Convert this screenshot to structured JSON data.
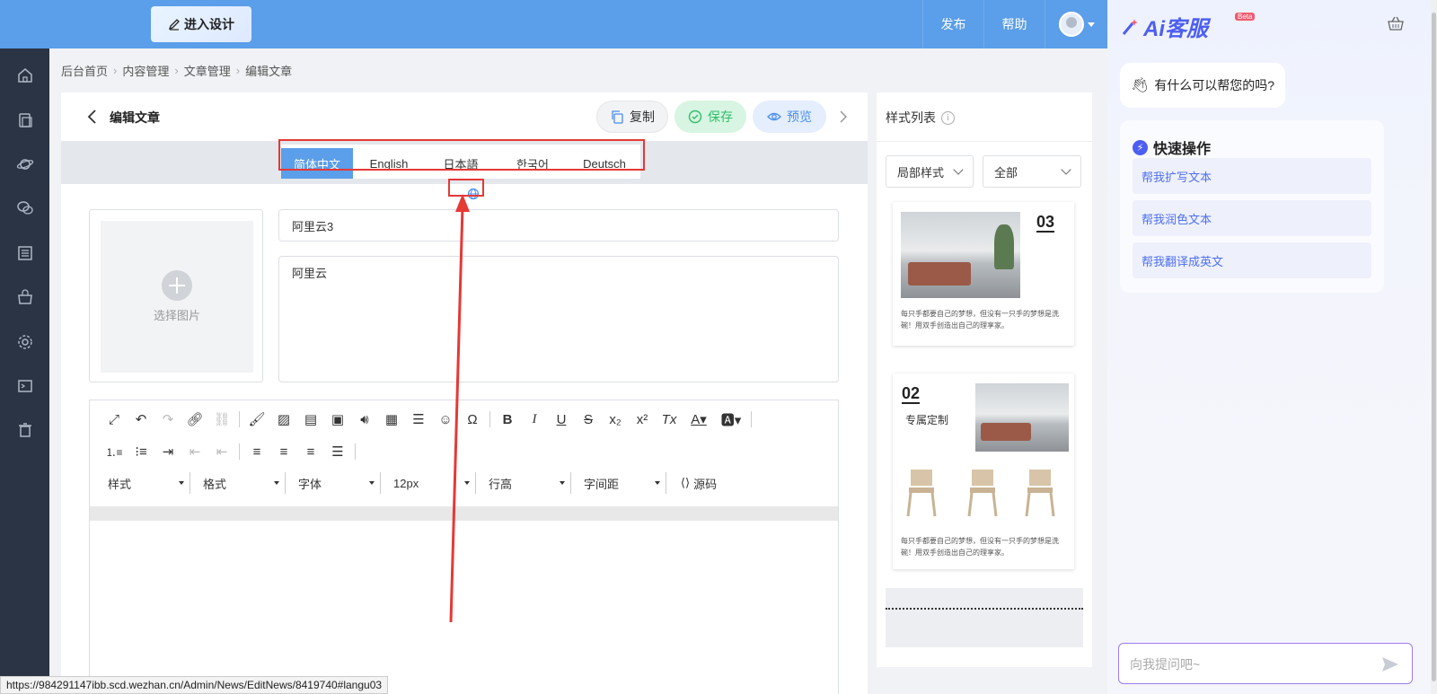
{
  "topbar": {
    "design_button": "进入设计",
    "publish": "发布",
    "help": "帮助"
  },
  "sidebar": {
    "icons": [
      "home-icon",
      "document-icon",
      "planet-icon",
      "chat-icon",
      "list-icon",
      "bag-icon",
      "gear-icon",
      "terminal-icon",
      "trash-icon"
    ]
  },
  "breadcrumb": [
    "后台首页",
    "内容管理",
    "文章管理",
    "编辑文章"
  ],
  "editor": {
    "title": "编辑文章",
    "copy_label": "复制",
    "save_label": "保存",
    "preview_label": "预览",
    "languages": [
      "简体中文",
      "English",
      "日本語",
      "한국어",
      "Deutsch"
    ],
    "active_language": "简体中文",
    "image_placeholder": "选择图片",
    "title_value": "阿里云3",
    "description_value": "阿里云",
    "toolbar_selects": [
      "样式",
      "格式",
      "字体",
      "12px",
      "行高",
      "字间距"
    ],
    "source_label": "源码"
  },
  "style_list": {
    "title": "样式列表",
    "filter_scope": "局部样式",
    "filter_category": "全部",
    "card1": {
      "number": "03",
      "text": "每只手都要自己的梦想，但没有一只手的梦想是洗碗！用双手创造出自己的理享家。"
    },
    "card2": {
      "number": "02",
      "heading": "专属定制",
      "text": "每只手都要自己的梦想，但没有一只手的梦想是洗碗！用双手创造出自己的理享家。"
    }
  },
  "ai": {
    "brand": "Ai客服",
    "badge": "Beta",
    "greeting": "有什么可以帮您的吗?",
    "quick_title": "快速操作",
    "quick_actions": [
      "帮我扩写文本",
      "帮我润色文本",
      "帮我翻译成英文"
    ],
    "input_placeholder": "向我提问吧~"
  },
  "status_url": "https://984291147ibb.scd.wezhan.cn/Admin/News/EditNews/8419740#langu03",
  "colors": {
    "topbar": "#5b9ee9",
    "sidebar": "#2b3445",
    "save_green": "#2fbe6a",
    "ai_accent": "#4d5ff0",
    "annotation_red": "#e53935"
  }
}
